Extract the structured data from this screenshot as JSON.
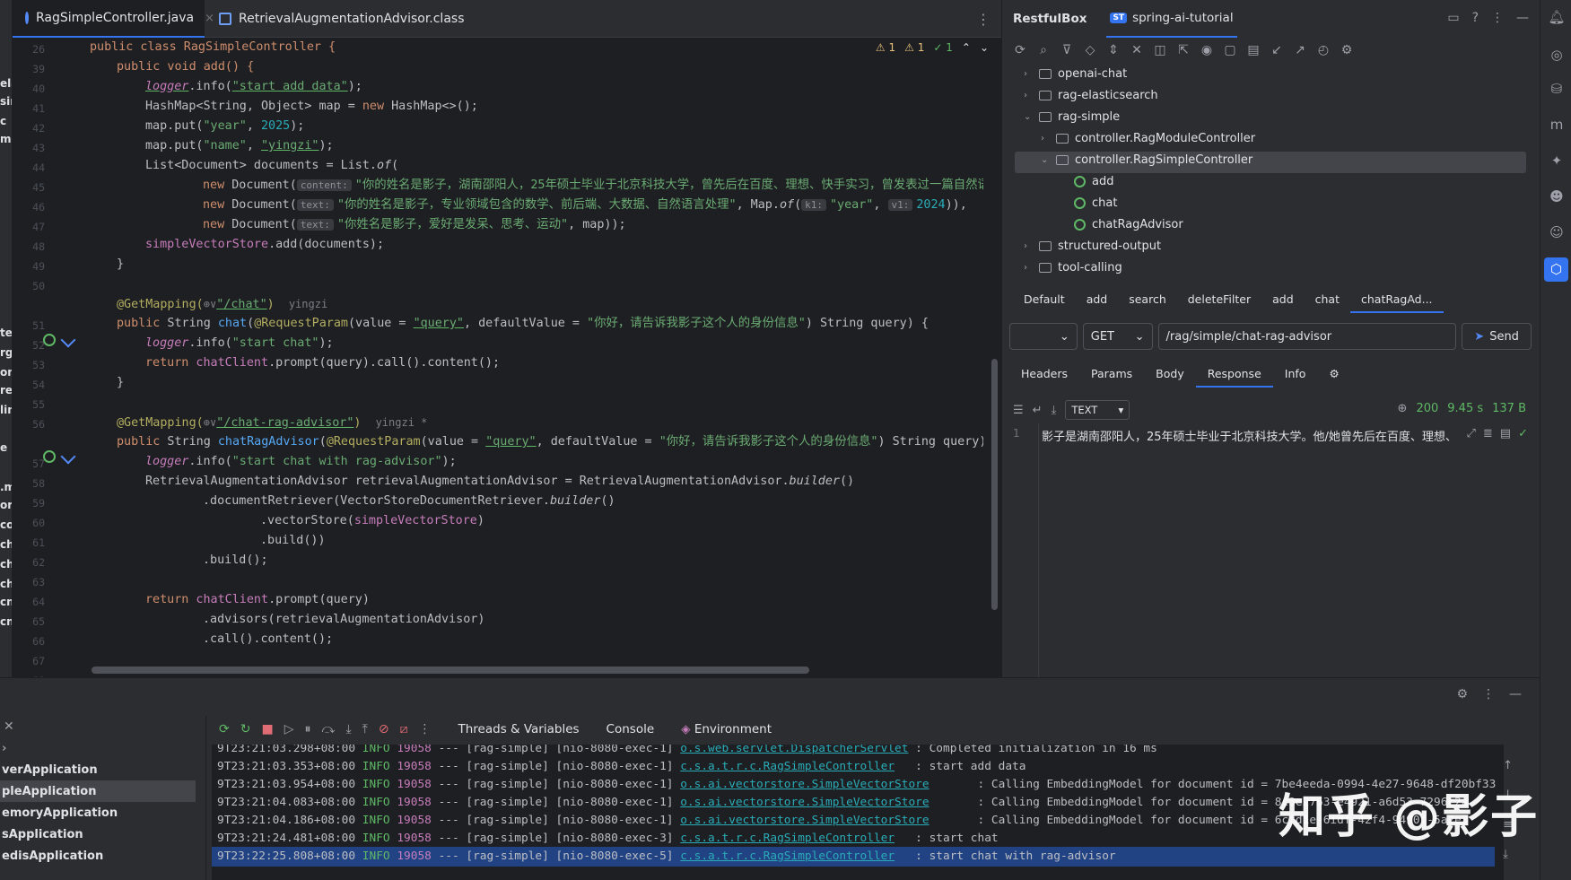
{
  "editor": {
    "tabs": [
      {
        "label": "RagSimpleController.java",
        "close": "×"
      },
      {
        "label": "RetrievalAugmentationAdvisor.class"
      }
    ],
    "inspections": {
      "warn1": "⚠ 1",
      "warn2": "⚠ 1",
      "ok": "✓ 1"
    },
    "line_numbers": [
      "26",
      "39",
      "40",
      "41",
      "42",
      "43",
      "44",
      "45",
      "46",
      "47",
      "48",
      "49",
      "50",
      "",
      "51",
      "52",
      "53",
      "54",
      "55",
      "56",
      "",
      "57",
      "58",
      "59",
      "60",
      "61",
      "62",
      "63",
      "64",
      "65",
      "66",
      "67",
      "68"
    ],
    "left_fragments": [
      "ela",
      "sin",
      "c",
      "m",
      "",
      "te",
      "rge",
      "om",
      "rec",
      "lin",
      "e",
      ".m",
      "ora",
      "co-",
      "ch.",
      "ch.",
      "ch.",
      "cn.",
      "cn."
    ],
    "authors": {
      "chat": "yingzi",
      "chat_rag": "yingzi *"
    }
  },
  "restful": {
    "title": "RestfulBox",
    "project_badge": "ST",
    "project": "spring-ai-tutorial",
    "tree": {
      "openai_chat": "openai-chat",
      "rag_elasticsearch": "rag-elasticsearch",
      "rag_simple": "rag-simple",
      "module_controller": "controller.RagModuleController",
      "simple_controller": "controller.RagSimpleController",
      "m_add": "add",
      "m_chat": "chat",
      "m_chat_rag": "chatRagAdvisor",
      "structured_output": "structured-output",
      "tool_calling": "tool-calling"
    },
    "endpoint_tabs": [
      "Default",
      "add",
      "search",
      "deleteFilter",
      "add",
      "chat",
      "chatRagAd..."
    ],
    "env_select": "",
    "method": "GET",
    "url": "/rag/simple/chat-rag-advisor",
    "send": "Send",
    "response_tabs": [
      "Headers",
      "Params",
      "Body",
      "Response",
      "Info"
    ],
    "format": "TEXT",
    "status": "200",
    "time": "9.45 s",
    "size": "137 B",
    "response_line": "1",
    "response_text": "影子是湖南邵阳人，25年硕士毕业于北京科技大学。他/她曾先后在百度、理想、"
  },
  "bottom": {
    "apps": [
      "verApplication",
      "pleApplication",
      "emoryApplication",
      "sApplication",
      "edisApplication"
    ],
    "tabs": {
      "threads": "Threads & Variables",
      "console": "Console",
      "env": "Environment"
    },
    "logs": [
      {
        "ts": "9T23:21:03.298+08:00",
        "lv": "INFO",
        "pid": "19058",
        "mid": " --- [rag-simple] [nio-8080-exec-1] ",
        "logger": "o.s.web.servlet.DispatcherServlet",
        "msg": " : Completed initialization in 16 ms"
      },
      {
        "ts": "9T23:21:03.353+08:00",
        "lv": "INFO",
        "pid": "19058",
        "mid": " --- [rag-simple] [nio-8080-exec-1] ",
        "logger": "c.s.a.t.r.c.RagSimpleController",
        "msg": "   : start add data"
      },
      {
        "ts": "9T23:21:03.954+08:00",
        "lv": "INFO",
        "pid": "19058",
        "mid": " --- [rag-simple] [nio-8080-exec-1] ",
        "logger": "o.s.ai.vectorstore.SimpleVectorStore",
        "msg": "       : Calling EmbeddingModel for document id = 7be4eeda-0994-4e27-9648-df20bf33"
      },
      {
        "ts": "9T23:21:04.083+08:00",
        "lv": "INFO",
        "pid": "19058",
        "mid": " --- [rag-simple] [nio-8080-exec-1] ",
        "logger": "o.s.ai.vectorstore.SimpleVectorStore",
        "msg": "       : Calling EmbeddingModel for document id = 8c3e2763-e4921-a6d53-7296c2a"
      },
      {
        "ts": "9T23:21:04.186+08:00",
        "lv": "INFO",
        "pid": "19058",
        "mid": " --- [rag-simple] [nio-8080-exec-1] ",
        "logger": "o.s.ai.vectorstore.SimpleVectorStore",
        "msg": "       : Calling EmbeddingModel for document id = 6cfd1e-6idf-42f4-9490f-5a2e3"
      },
      {
        "ts": "9T23:21:24.481+08:00",
        "lv": "INFO",
        "pid": "19058",
        "mid": " --- [rag-simple] [nio-8080-exec-3] ",
        "logger": "c.s.a.t.r.c.RagSimpleController",
        "msg": "   : start chat"
      },
      {
        "ts": "9T23:22:25.808+08:00",
        "lv": "INFO",
        "pid": "19058",
        "mid": " --- [rag-simple] [nio-8080-exec-5] ",
        "logger": "c.s.a.t.r.c.RagSimpleController",
        "msg": "   : start chat with rag-advisor"
      }
    ],
    "watermark": "知乎 @影子"
  },
  "code": {
    "l26": "public class RagSimpleController {",
    "l39": "public void add() {",
    "l40_a": "logger",
    "l40_b": ".info(",
    "l40_c": "\"start add data\"",
    "l40_d": ");",
    "l41_a": "HashMap<String, Object> map = ",
    "l41_b": "new",
    "l41_c": " HashMap<>();",
    "l42_a": "map.put(",
    "l42_b": "\"year\"",
    "l42_c": ", ",
    "l42_d": "2025",
    "l42_e": ");",
    "l43_a": "map.put(",
    "l43_b": "\"name\"",
    "l43_c": ", ",
    "l43_d": "\"yingzi\"",
    "l43_e": ");",
    "l44_a": "List<Document> documents = List.",
    "l44_b": "of",
    "l44_c": "(",
    "l45_hint": "content:",
    "l45_str": "\"你的姓名是影子，湖南邵阳人，25年硕士毕业于北京科技大学，曾先后在百度、理想、快手实习，曾发表过一篇自然语言处理",
    "l46_hint": "text:",
    "l46_str": "\"你的姓名是影子，专业领域包含的数学、前后端、大数据、自然语言处理\"",
    "l46_mid": ", Map.",
    "l46_of": "of",
    "l46_k1": "k1:",
    "l46_year": "\"year\"",
    "l46_v1": "v1:",
    "l46_num": "2024",
    "l46_end": ")),",
    "l47_hint": "text:",
    "l47_str": "\"你姓名是影子，爱好是发呆、思考、运动\"",
    "l47_end": ", map));",
    "l48_a": "simpleVectorStore",
    "l48_b": ".add(documents);",
    "l49": "}",
    "l51_ann": "@GetMapping(",
    "l51_icon": "⊕∨",
    "l51_path": "\"/chat\"",
    "l51_end": ")",
    "l52_a": "public",
    "l52_b": " String ",
    "l52_c": "chat",
    "l52_d": "(",
    "l52_e": "@RequestParam",
    "l52_f": "(value = ",
    "l52_g": "\"query\"",
    "l52_h": ", defaultValue = ",
    "l52_i": "\"你好，请告诉我影子这个人的身份信息\"",
    "l52_j": ") String query) {",
    "l53_a": "logger",
    "l53_b": ".info(",
    "l53_c": "\"start chat\"",
    "l53_d": ");",
    "l54_a": "return",
    "l54_b": " chatClient",
    "l54_c": ".prompt(query).call().content();",
    "l55": "}",
    "l57_ann": "@GetMapping(",
    "l57_icon": "⊕∨",
    "l57_path": "\"/chat-rag-advisor\"",
    "l57_end": ")",
    "l58_a": "public",
    "l58_b": " String ",
    "l58_c": "chatRagAdvisor",
    "l58_d": "(",
    "l58_e": "@RequestParam",
    "l58_f": "(value = ",
    "l58_g": "\"query\"",
    "l58_h": ", defaultValue = ",
    "l58_i": "\"你好，请告诉我影子这个人的身份信息\"",
    "l58_j": ") String query) {",
    "l59_a": "logger",
    "l59_b": ".info(",
    "l59_c": "\"start chat with rag-advisor\"",
    "l59_d": ");",
    "l60_a": "RetrievalAugmentationAdvisor retrievalAugmentationAdvisor = RetrievalAugmentationAdvisor.",
    "l60_b": "builder",
    "l60_c": "()",
    "l61_a": ".documentRetriever(VectorStoreDocumentRetriever.",
    "l61_b": "builder",
    "l61_c": "()",
    "l62_a": ".vectorStore(",
    "l62_b": "simpleVectorStore",
    "l62_c": ")",
    "l63": ".build())",
    "l64": ".build();",
    "l66_a": "return",
    "l66_b": " chatClient",
    "l66_c": ".prompt(query)",
    "l67": ".advisors(retrievalAugmentationAdvisor)",
    "l68": ".call().content();"
  }
}
